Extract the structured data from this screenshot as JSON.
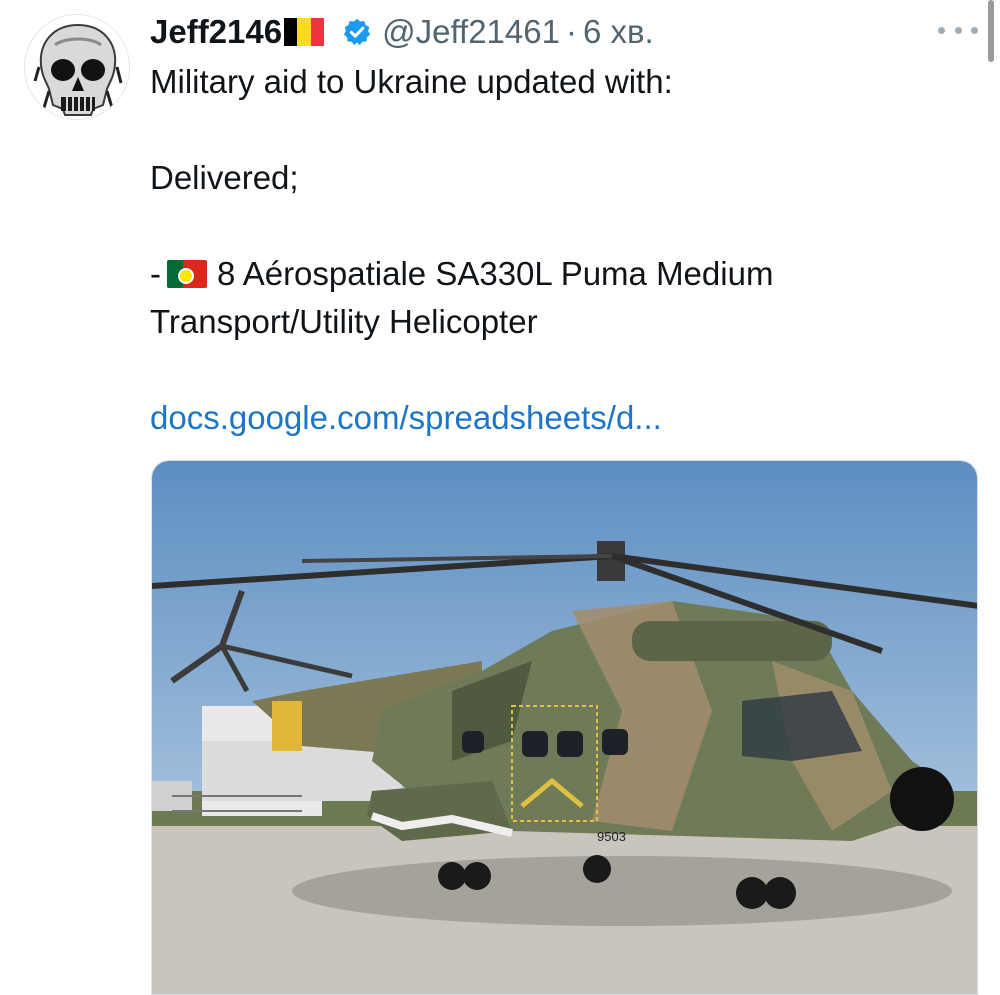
{
  "author": {
    "display_name": "Jeff2146",
    "handle": "@Jeff21461",
    "separator": "·",
    "time": "6 хв.",
    "flag": "belgium-flag",
    "verified": "verified-badge-icon",
    "avatar": "skull-avatar"
  },
  "menu": {
    "icon": "more-options-icon"
  },
  "tweet": {
    "line1": "Military aid to Ukraine updated with:",
    "line2": "Delivered;",
    "item_prefix": "-",
    "item_flag": "portugal-flag",
    "item_line1": "8 Aérospatiale SA330L Puma Medium",
    "item_line2": "Transport/Utility Helicopter",
    "link": "docs.google.com/spreadsheets/d..."
  },
  "media": {
    "description_icon": "helicopter-photo",
    "tail_number": "9503"
  },
  "colors": {
    "link": "#1d75c6",
    "secondary_text": "#536471",
    "verified": "#1d9bf0",
    "sky": "#6f9cc7",
    "tarmac": "#c9c5bd"
  }
}
